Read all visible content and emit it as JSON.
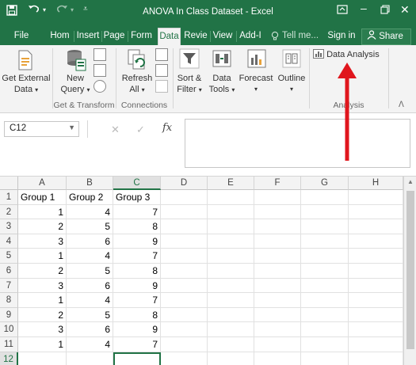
{
  "window": {
    "title": "ANOVA In Class Dataset - Excel",
    "save_icon": "save-icon",
    "undo_icon": "undo-icon",
    "redo_icon": "redo-icon"
  },
  "tabs": [
    {
      "label": "File"
    },
    {
      "label": "Hom"
    },
    {
      "label": "Insert"
    },
    {
      "label": "Page"
    },
    {
      "label": "Form"
    },
    {
      "label": "Data"
    },
    {
      "label": "Revie"
    },
    {
      "label": "View"
    },
    {
      "label": "Add-I"
    }
  ],
  "tell_me": "Tell me...",
  "sign_in": "Sign in",
  "share": "Share",
  "ribbon": {
    "get_external_1": "Get External",
    "get_external_2": "Data",
    "new_query_1": "New",
    "new_query_2": "Query",
    "refresh_1": "Refresh",
    "refresh_2": "All",
    "sort_filter_1": "Sort &",
    "sort_filter_2": "Filter",
    "data_tools_1": "Data",
    "data_tools_2": "Tools",
    "forecast": "Forecast",
    "outline": "Outline",
    "data_analysis": "Data Analysis",
    "group_get_transform": "Get & Transform",
    "group_connections": "Connections",
    "group_analysis": "Analysis"
  },
  "formula_bar": {
    "name_box": "C12",
    "cancel": "✕",
    "enter": "✓",
    "fx": "fx",
    "value": ""
  },
  "sheet": {
    "columns": [
      "A",
      "B",
      "C",
      "D",
      "E",
      "F",
      "G",
      "H"
    ],
    "rows": [
      [
        "Group 1",
        "Group 2",
        "Group 3"
      ],
      [
        "1",
        "4",
        "7"
      ],
      [
        "2",
        "5",
        "8"
      ],
      [
        "3",
        "6",
        "9"
      ],
      [
        "1",
        "4",
        "7"
      ],
      [
        "2",
        "5",
        "8"
      ],
      [
        "3",
        "6",
        "9"
      ],
      [
        "1",
        "4",
        "7"
      ],
      [
        "2",
        "5",
        "8"
      ],
      [
        "3",
        "6",
        "9"
      ],
      [
        "1",
        "4",
        "7"
      ],
      [
        "",
        "",
        ""
      ]
    ],
    "row_numbers": [
      "1",
      "2",
      "3",
      "4",
      "5",
      "6",
      "7",
      "8",
      "9",
      "10",
      "11",
      "12"
    ],
    "selected_cell": "C12"
  },
  "annotation": {
    "arrow_color": "#e0161d"
  },
  "colors": {
    "accent": "#217346"
  }
}
